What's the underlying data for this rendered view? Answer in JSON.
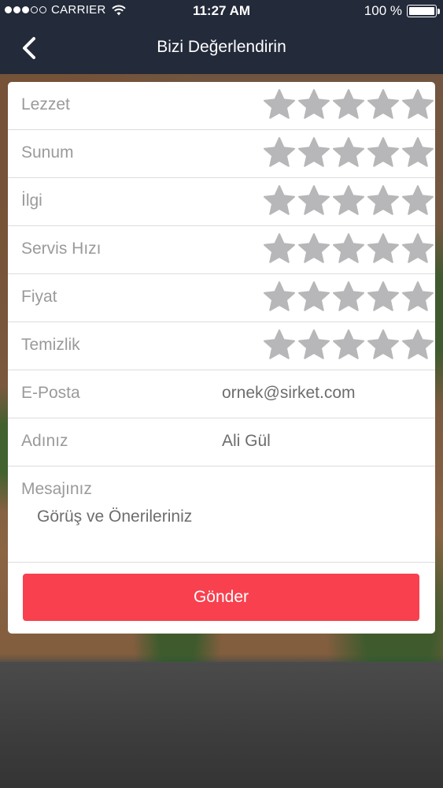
{
  "status_bar": {
    "carrier": "CARRIER",
    "time": "11:27 AM",
    "battery": "100 %",
    "signal_bars_filled": 3,
    "signal_bars_total": 5
  },
  "nav": {
    "title": "Bizi Değerlendirin",
    "back_icon": "chevron-left-icon"
  },
  "ratings": [
    {
      "label": "Lezzet",
      "stars_filled": 0,
      "stars_total": 5
    },
    {
      "label": "Sunum",
      "stars_filled": 0,
      "stars_total": 5
    },
    {
      "label": "İlgi",
      "stars_filled": 0,
      "stars_total": 5
    },
    {
      "label": "Servis Hızı",
      "stars_filled": 0,
      "stars_total": 5
    },
    {
      "label": "Fiyat",
      "stars_filled": 0,
      "stars_total": 5
    },
    {
      "label": "Temizlik",
      "stars_filled": 0,
      "stars_total": 5
    }
  ],
  "fields": {
    "email": {
      "label": "E-Posta",
      "value": "ornek@sirket.com"
    },
    "name": {
      "label": "Adınız",
      "value": "Ali Gül"
    },
    "message": {
      "label": "Mesajınız",
      "placeholder": "Görüş ve Önerileriniz"
    }
  },
  "submit": {
    "label": "Gönder"
  },
  "colors": {
    "nav_bg": "#232a3a",
    "star_empty": "#b7b7b9",
    "submit_bg": "#f8404f",
    "label_text": "#9a9a9a",
    "value_text": "#6d6d6d"
  }
}
